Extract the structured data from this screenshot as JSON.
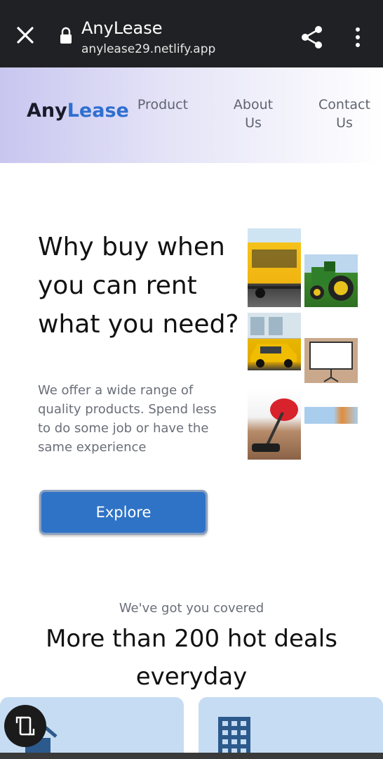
{
  "browser": {
    "title": "AnyLease",
    "url": "anylease29.netlify.app",
    "icons": {
      "close": "close-icon",
      "lock": "lock-icon",
      "share": "share-icon",
      "menu": "more-vert-icon"
    }
  },
  "site": {
    "logo_part1": "Any",
    "logo_part2": "Lease",
    "nav": [
      {
        "label_line1": "Product",
        "label_line2": ""
      },
      {
        "label_line1": "About",
        "label_line2": "Us"
      },
      {
        "label_line1": "Contact",
        "label_line2": "Us"
      }
    ]
  },
  "hero": {
    "title": "Why buy when you can rent what you need?",
    "description": "We offer a wide range of quality products. Spend less to do some job or have the same experience",
    "button": "Explore",
    "images": [
      "bus",
      "tractor",
      "car",
      "projector-screen",
      "vacuum-cleaner",
      "crane"
    ]
  },
  "section": {
    "subtitle": "We've got you covered",
    "title": "More than 200 hot deals everyday"
  },
  "colors": {
    "brand_dark": "#1a1a2a",
    "brand_blue": "#2f6fd0",
    "button": "#2f73c6",
    "card": "#c6dcf3"
  }
}
